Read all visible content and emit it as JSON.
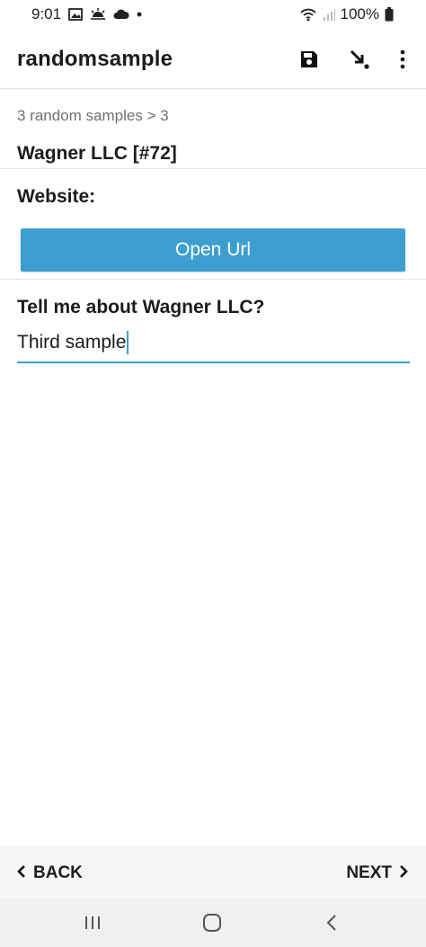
{
  "status_bar": {
    "time": "9:01",
    "battery": "100%",
    "icons_left": [
      "image-icon",
      "sunrise-icon",
      "cloud-icon",
      "dot-icon"
    ],
    "icons_right": [
      "wifi-icon",
      "signal-icon",
      "battery-icon"
    ]
  },
  "app_bar": {
    "title": "randomsample",
    "actions": [
      "save-icon",
      "jump-icon",
      "more-vert-icon"
    ]
  },
  "form": {
    "breadcrumb": "3 random samples > 3",
    "entity_title": "Wagner LLC [#72]",
    "website_label": "Website:",
    "open_url_label": "Open Url",
    "question_label": "Tell me about Wagner LLC?",
    "answer_value": "Third sample"
  },
  "bottom_nav": {
    "back_label": "BACK",
    "next_label": "NEXT"
  },
  "colors": {
    "accent": "#3d9fcf",
    "text": "#1c1c1c",
    "muted": "#707070"
  }
}
